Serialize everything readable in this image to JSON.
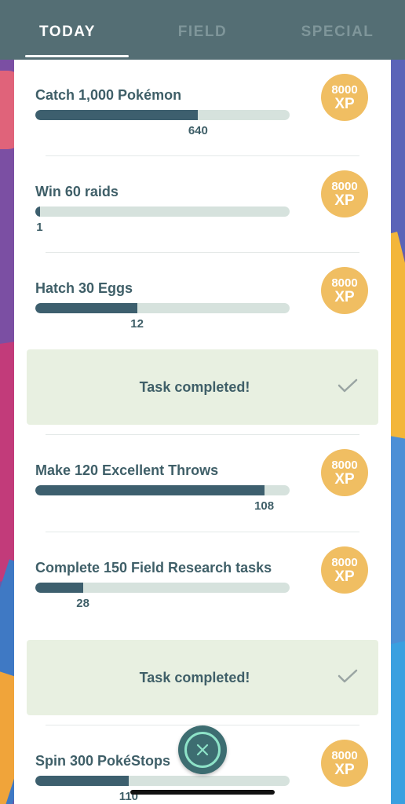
{
  "tabs": [
    {
      "label": "TODAY",
      "active": true
    },
    {
      "label": "FIELD",
      "active": false
    },
    {
      "label": "SPECIAL",
      "active": false
    }
  ],
  "xp_badge": {
    "amount": "8000",
    "unit": "XP",
    "color": "#f0be62"
  },
  "completed_text": "Task completed!",
  "tasks": [
    {
      "title": "Catch 1,000 Pokémon",
      "count": "640",
      "progress": 0.64
    },
    {
      "title": "Win 60 raids",
      "count": "1",
      "progress": 0.0167
    },
    {
      "title": "Hatch 30 Eggs",
      "count": "12",
      "progress": 0.4
    },
    {
      "title": "Make 120 Excellent Throws",
      "count": "108",
      "progress": 0.9
    },
    {
      "title": "Complete 150 Field Research tasks",
      "count": "28",
      "progress": 0.187
    },
    {
      "title": "Spin 300 PokéStops",
      "count": "110",
      "progress": 0.367
    }
  ],
  "colors": {
    "header": "#546e74",
    "bar_fill": "#3d5f6e",
    "bar_track": "#d6e2dd",
    "completed_bg": "#e8f0e1"
  },
  "icons": {
    "check": "check-icon",
    "close": "close-icon"
  }
}
